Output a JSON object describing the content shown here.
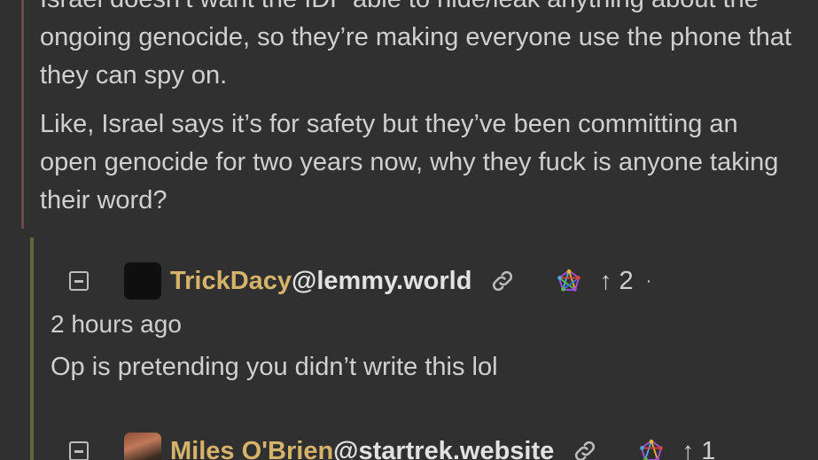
{
  "parent": {
    "paragraph_1": "Israel doesn’t want the IDF able to hide/leak anything about the ongoing genocide, so they’re making everyone use the phone that they can spy on.",
    "paragraph_2": "Like, Israel says it’s for safety but they’ve been committing an open genocide for two years now, why they fuck is anyone taking their word?"
  },
  "reply": {
    "username": "TrickDacy",
    "instance": "@lemmy.world",
    "vote_arrow": "↑",
    "score": "2",
    "separator": "·",
    "timestamp": "2 hours ago",
    "body": "Op is pretending you didn’t write this lol",
    "icons": [
      "collapse-icon",
      "avatar",
      "link-icon",
      "fediverse-icon",
      "upvote-icon"
    ]
  },
  "next_reply": {
    "username": "Miles O'Brien",
    "instance": "@startrek.website",
    "vote_arrow": "↑",
    "score": "1"
  },
  "colors": {
    "background": "#303030",
    "username": "#d6b36a",
    "parent_thread_line": "#6b4a47",
    "child_thread_line": "#5f6a3d"
  }
}
